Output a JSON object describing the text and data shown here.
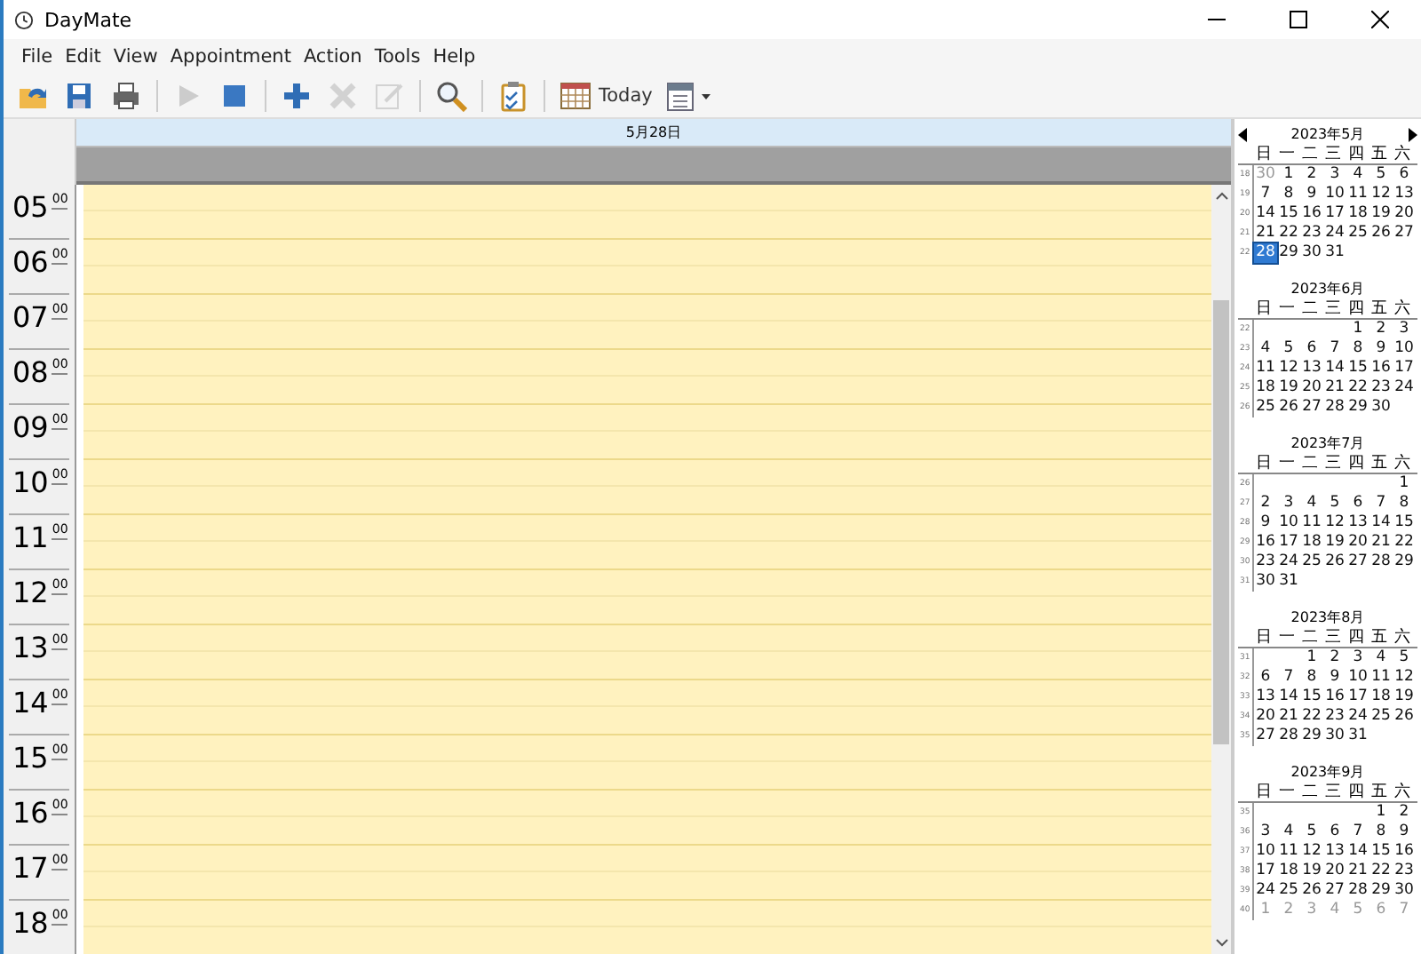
{
  "window": {
    "title": "DayMate"
  },
  "menu": [
    {
      "label": "File"
    },
    {
      "label": "Edit"
    },
    {
      "label": "View"
    },
    {
      "label": "Appointment"
    },
    {
      "label": "Action"
    },
    {
      "label": "Tools"
    },
    {
      "label": "Help"
    }
  ],
  "toolbar": [
    {
      "kind": "open",
      "disabled": false
    },
    {
      "kind": "save",
      "disabled": false
    },
    {
      "kind": "print",
      "disabled": false
    },
    {
      "kind": "separator"
    },
    {
      "kind": "play",
      "disabled": true
    },
    {
      "kind": "stop",
      "disabled": false
    },
    {
      "kind": "separator"
    },
    {
      "kind": "add",
      "disabled": false
    },
    {
      "kind": "delete",
      "disabled": true
    },
    {
      "kind": "edit",
      "disabled": true
    },
    {
      "kind": "separator"
    },
    {
      "kind": "search",
      "disabled": false
    },
    {
      "kind": "separator"
    },
    {
      "kind": "tasks",
      "disabled": false
    },
    {
      "kind": "separator"
    },
    {
      "kind": "today",
      "label": "Today",
      "disabled": false
    },
    {
      "kind": "calendar",
      "disabled": false
    }
  ],
  "day_view": {
    "date": "5月28日",
    "hours": [
      {
        "hour": "05",
        "minutes": "00"
      },
      {
        "hour": "06",
        "minutes": "00"
      },
      {
        "hour": "07",
        "minutes": "00"
      },
      {
        "hour": "08",
        "minutes": "00"
      },
      {
        "hour": "09",
        "minutes": "00"
      },
      {
        "hour": "10",
        "minutes": "00"
      },
      {
        "hour": "11",
        "minutes": "00"
      },
      {
        "hour": "12",
        "minutes": "00"
      },
      {
        "hour": "13",
        "minutes": "00"
      },
      {
        "hour": "14",
        "minutes": "00"
      },
      {
        "hour": "15",
        "minutes": "00"
      },
      {
        "hour": "16",
        "minutes": "00"
      },
      {
        "hour": "17",
        "minutes": "00"
      },
      {
        "hour": "18",
        "minutes": "00"
      }
    ]
  },
  "calendar": {
    "months": [
      {
        "title": "2023年5月",
        "weekdays": [
          "日",
          "一",
          "二",
          "三",
          "四",
          "五",
          "六"
        ],
        "weeks": [
          {
            "number": "18",
            "days": [
              {
                "text": "30",
                "other": true,
                "selected": false
              },
              {
                "text": "1",
                "other": false,
                "selected": false
              },
              {
                "text": "2",
                "other": false,
                "selected": false
              },
              {
                "text": "3",
                "other": false,
                "selected": false
              },
              {
                "text": "4",
                "other": false,
                "selected": false
              },
              {
                "text": "5",
                "other": false,
                "selected": false
              },
              {
                "text": "6",
                "other": false,
                "selected": false
              }
            ]
          },
          {
            "number": "19",
            "days": [
              {
                "text": "7",
                "other": false,
                "selected": false
              },
              {
                "text": "8",
                "other": false,
                "selected": false
              },
              {
                "text": "9",
                "other": false,
                "selected": false
              },
              {
                "text": "10",
                "other": false,
                "selected": false
              },
              {
                "text": "11",
                "other": false,
                "selected": false
              },
              {
                "text": "12",
                "other": false,
                "selected": false
              },
              {
                "text": "13",
                "other": false,
                "selected": false
              }
            ]
          },
          {
            "number": "20",
            "days": [
              {
                "text": "14",
                "other": false,
                "selected": false
              },
              {
                "text": "15",
                "other": false,
                "selected": false
              },
              {
                "text": "16",
                "other": false,
                "selected": false
              },
              {
                "text": "17",
                "other": false,
                "selected": false
              },
              {
                "text": "18",
                "other": false,
                "selected": false
              },
              {
                "text": "19",
                "other": false,
                "selected": false
              },
              {
                "text": "20",
                "other": false,
                "selected": false
              }
            ]
          },
          {
            "number": "21",
            "days": [
              {
                "text": "21",
                "other": false,
                "selected": false
              },
              {
                "text": "22",
                "other": false,
                "selected": false
              },
              {
                "text": "23",
                "other": false,
                "selected": false
              },
              {
                "text": "24",
                "other": false,
                "selected": false
              },
              {
                "text": "25",
                "other": false,
                "selected": false
              },
              {
                "text": "26",
                "other": false,
                "selected": false
              },
              {
                "text": "27",
                "other": false,
                "selected": false
              }
            ]
          },
          {
            "number": "22",
            "days": [
              {
                "text": "28",
                "other": false,
                "selected": true
              },
              {
                "text": "29",
                "other": false,
                "selected": false
              },
              {
                "text": "30",
                "other": false,
                "selected": false
              },
              {
                "text": "31",
                "other": false,
                "selected": false
              }
            ]
          }
        ]
      },
      {
        "title": "2023年6月",
        "weekdays": [
          "日",
          "一",
          "二",
          "三",
          "四",
          "五",
          "六"
        ],
        "weeks": [
          {
            "number": "22",
            "days": [
              {
                "text": "1",
                "other": false,
                "selected": false
              },
              {
                "text": "2",
                "other": false,
                "selected": false
              },
              {
                "text": "3",
                "other": false,
                "selected": false
              }
            ]
          },
          {
            "number": "23",
            "days": [
              {
                "text": "4",
                "other": false,
                "selected": false
              },
              {
                "text": "5",
                "other": false,
                "selected": false
              },
              {
                "text": "6",
                "other": false,
                "selected": false
              },
              {
                "text": "7",
                "other": false,
                "selected": false
              },
              {
                "text": "8",
                "other": false,
                "selected": false
              },
              {
                "text": "9",
                "other": false,
                "selected": false
              },
              {
                "text": "10",
                "other": false,
                "selected": false
              }
            ]
          },
          {
            "number": "24",
            "days": [
              {
                "text": "11",
                "other": false,
                "selected": false
              },
              {
                "text": "12",
                "other": false,
                "selected": false
              },
              {
                "text": "13",
                "other": false,
                "selected": false
              },
              {
                "text": "14",
                "other": false,
                "selected": false
              },
              {
                "text": "15",
                "other": false,
                "selected": false
              },
              {
                "text": "16",
                "other": false,
                "selected": false
              },
              {
                "text": "17",
                "other": false,
                "selected": false
              }
            ]
          },
          {
            "number": "25",
            "days": [
              {
                "text": "18",
                "other": false,
                "selected": false
              },
              {
                "text": "19",
                "other": false,
                "selected": false
              },
              {
                "text": "20",
                "other": false,
                "selected": false
              },
              {
                "text": "21",
                "other": false,
                "selected": false
              },
              {
                "text": "22",
                "other": false,
                "selected": false
              },
              {
                "text": "23",
                "other": false,
                "selected": false
              },
              {
                "text": "24",
                "other": false,
                "selected": false
              }
            ]
          },
          {
            "number": "26",
            "days": [
              {
                "text": "25",
                "other": false,
                "selected": false
              },
              {
                "text": "26",
                "other": false,
                "selected": false
              },
              {
                "text": "27",
                "other": false,
                "selected": false
              },
              {
                "text": "28",
                "other": false,
                "selected": false
              },
              {
                "text": "29",
                "other": false,
                "selected": false
              },
              {
                "text": "30",
                "other": false,
                "selected": false
              }
            ]
          }
        ]
      },
      {
        "title": "2023年7月",
        "weekdays": [
          "日",
          "一",
          "二",
          "三",
          "四",
          "五",
          "六"
        ],
        "weeks": [
          {
            "number": "26",
            "days": [
              {
                "text": "1",
                "other": false,
                "selected": false
              }
            ]
          },
          {
            "number": "27",
            "days": [
              {
                "text": "2",
                "other": false,
                "selected": false
              },
              {
                "text": "3",
                "other": false,
                "selected": false
              },
              {
                "text": "4",
                "other": false,
                "selected": false
              },
              {
                "text": "5",
                "other": false,
                "selected": false
              },
              {
                "text": "6",
                "other": false,
                "selected": false
              },
              {
                "text": "7",
                "other": false,
                "selected": false
              },
              {
                "text": "8",
                "other": false,
                "selected": false
              }
            ]
          },
          {
            "number": "28",
            "days": [
              {
                "text": "9",
                "other": false,
                "selected": false
              },
              {
                "text": "10",
                "other": false,
                "selected": false
              },
              {
                "text": "11",
                "other": false,
                "selected": false
              },
              {
                "text": "12",
                "other": false,
                "selected": false
              },
              {
                "text": "13",
                "other": false,
                "selected": false
              },
              {
                "text": "14",
                "other": false,
                "selected": false
              },
              {
                "text": "15",
                "other": false,
                "selected": false
              }
            ]
          },
          {
            "number": "29",
            "days": [
              {
                "text": "16",
                "other": false,
                "selected": false
              },
              {
                "text": "17",
                "other": false,
                "selected": false
              },
              {
                "text": "18",
                "other": false,
                "selected": false
              },
              {
                "text": "19",
                "other": false,
                "selected": false
              },
              {
                "text": "20",
                "other": false,
                "selected": false
              },
              {
                "text": "21",
                "other": false,
                "selected": false
              },
              {
                "text": "22",
                "other": false,
                "selected": false
              }
            ]
          },
          {
            "number": "30",
            "days": [
              {
                "text": "23",
                "other": false,
                "selected": false
              },
              {
                "text": "24",
                "other": false,
                "selected": false
              },
              {
                "text": "25",
                "other": false,
                "selected": false
              },
              {
                "text": "26",
                "other": false,
                "selected": false
              },
              {
                "text": "27",
                "other": false,
                "selected": false
              },
              {
                "text": "28",
                "other": false,
                "selected": false
              },
              {
                "text": "29",
                "other": false,
                "selected": false
              }
            ]
          },
          {
            "number": "31",
            "days": [
              {
                "text": "30",
                "other": false,
                "selected": false
              },
              {
                "text": "31",
                "other": false,
                "selected": false
              }
            ]
          }
        ]
      },
      {
        "title": "2023年8月",
        "weekdays": [
          "日",
          "一",
          "二",
          "三",
          "四",
          "五",
          "六"
        ],
        "weeks": [
          {
            "number": "31",
            "days": [
              {
                "text": "1",
                "other": false,
                "selected": false
              },
              {
                "text": "2",
                "other": false,
                "selected": false
              },
              {
                "text": "3",
                "other": false,
                "selected": false
              },
              {
                "text": "4",
                "other": false,
                "selected": false
              },
              {
                "text": "5",
                "other": false,
                "selected": false
              }
            ]
          },
          {
            "number": "32",
            "days": [
              {
                "text": "6",
                "other": false,
                "selected": false
              },
              {
                "text": "7",
                "other": false,
                "selected": false
              },
              {
                "text": "8",
                "other": false,
                "selected": false
              },
              {
                "text": "9",
                "other": false,
                "selected": false
              },
              {
                "text": "10",
                "other": false,
                "selected": false
              },
              {
                "text": "11",
                "other": false,
                "selected": false
              },
              {
                "text": "12",
                "other": false,
                "selected": false
              }
            ]
          },
          {
            "number": "33",
            "days": [
              {
                "text": "13",
                "other": false,
                "selected": false
              },
              {
                "text": "14",
                "other": false,
                "selected": false
              },
              {
                "text": "15",
                "other": false,
                "selected": false
              },
              {
                "text": "16",
                "other": false,
                "selected": false
              },
              {
                "text": "17",
                "other": false,
                "selected": false
              },
              {
                "text": "18",
                "other": false,
                "selected": false
              },
              {
                "text": "19",
                "other": false,
                "selected": false
              }
            ]
          },
          {
            "number": "34",
            "days": [
              {
                "text": "20",
                "other": false,
                "selected": false
              },
              {
                "text": "21",
                "other": false,
                "selected": false
              },
              {
                "text": "22",
                "other": false,
                "selected": false
              },
              {
                "text": "23",
                "other": false,
                "selected": false
              },
              {
                "text": "24",
                "other": false,
                "selected": false
              },
              {
                "text": "25",
                "other": false,
                "selected": false
              },
              {
                "text": "26",
                "other": false,
                "selected": false
              }
            ]
          },
          {
            "number": "35",
            "days": [
              {
                "text": "27",
                "other": false,
                "selected": false
              },
              {
                "text": "28",
                "other": false,
                "selected": false
              },
              {
                "text": "29",
                "other": false,
                "selected": false
              },
              {
                "text": "30",
                "other": false,
                "selected": false
              },
              {
                "text": "31",
                "other": false,
                "selected": false
              }
            ]
          }
        ]
      },
      {
        "title": "2023年9月",
        "weekdays": [
          "日",
          "一",
          "二",
          "三",
          "四",
          "五",
          "六"
        ],
        "weeks": [
          {
            "number": "35",
            "days": [
              {
                "text": "1",
                "other": false,
                "selected": false
              },
              {
                "text": "2",
                "other": false,
                "selected": false
              }
            ]
          },
          {
            "number": "36",
            "days": [
              {
                "text": "3",
                "other": false,
                "selected": false
              },
              {
                "text": "4",
                "other": false,
                "selected": false
              },
              {
                "text": "5",
                "other": false,
                "selected": false
              },
              {
                "text": "6",
                "other": false,
                "selected": false
              },
              {
                "text": "7",
                "other": false,
                "selected": false
              },
              {
                "text": "8",
                "other": false,
                "selected": false
              },
              {
                "text": "9",
                "other": false,
                "selected": false
              }
            ]
          },
          {
            "number": "37",
            "days": [
              {
                "text": "10",
                "other": false,
                "selected": false
              },
              {
                "text": "11",
                "other": false,
                "selected": false
              },
              {
                "text": "12",
                "other": false,
                "selected": false
              },
              {
                "text": "13",
                "other": false,
                "selected": false
              },
              {
                "text": "14",
                "other": false,
                "selected": false
              },
              {
                "text": "15",
                "other": false,
                "selected": false
              },
              {
                "text": "16",
                "other": false,
                "selected": false
              }
            ]
          },
          {
            "number": "38",
            "days": [
              {
                "text": "17",
                "other": false,
                "selected": false
              },
              {
                "text": "18",
                "other": false,
                "selected": false
              },
              {
                "text": "19",
                "other": false,
                "selected": false
              },
              {
                "text": "20",
                "other": false,
                "selected": false
              },
              {
                "text": "21",
                "other": false,
                "selected": false
              },
              {
                "text": "22",
                "other": false,
                "selected": false
              },
              {
                "text": "23",
                "other": false,
                "selected": false
              }
            ]
          },
          {
            "number": "39",
            "days": [
              {
                "text": "24",
                "other": false,
                "selected": false
              },
              {
                "text": "25",
                "other": false,
                "selected": false
              },
              {
                "text": "26",
                "other": false,
                "selected": false
              },
              {
                "text": "27",
                "other": false,
                "selected": false
              },
              {
                "text": "28",
                "other": false,
                "selected": false
              },
              {
                "text": "29",
                "other": false,
                "selected": false
              },
              {
                "text": "30",
                "other": false,
                "selected": false
              }
            ]
          },
          {
            "number": "40",
            "days": [
              {
                "text": "1",
                "other": true,
                "selected": false
              },
              {
                "text": "2",
                "other": true,
                "selected": false
              },
              {
                "text": "3",
                "other": true,
                "selected": false
              },
              {
                "text": "4",
                "other": true,
                "selected": false
              },
              {
                "text": "5",
                "other": true,
                "selected": false
              },
              {
                "text": "6",
                "other": true,
                "selected": false
              },
              {
                "text": "7",
                "other": true,
                "selected": false
              }
            ]
          }
        ]
      }
    ]
  }
}
